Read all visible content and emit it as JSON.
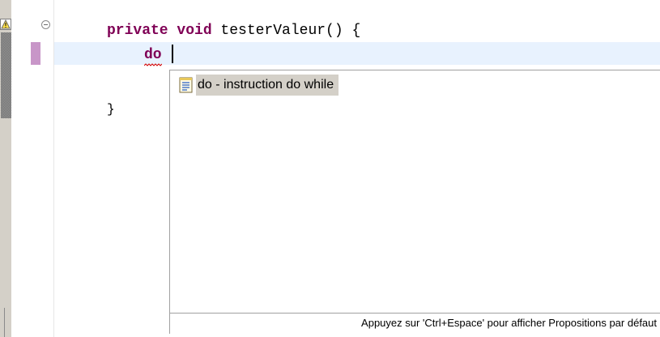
{
  "editor": {
    "lines": [
      {
        "keywords": "private void",
        "rest": " testerValeur() {"
      },
      {
        "text": "do"
      },
      {
        "text": "}"
      }
    ]
  },
  "content_assist": {
    "proposals": [
      {
        "label": "do - instruction do while",
        "icon": "template-icon"
      }
    ],
    "footer": "Appuyez sur 'Ctrl+Espace' pour afficher Propositions par défaut"
  },
  "colors": {
    "keyword": "#7f0055",
    "current_line": "#e8f2fe",
    "selection": "#d4d0c8",
    "ruler": "#d4d0c8"
  }
}
